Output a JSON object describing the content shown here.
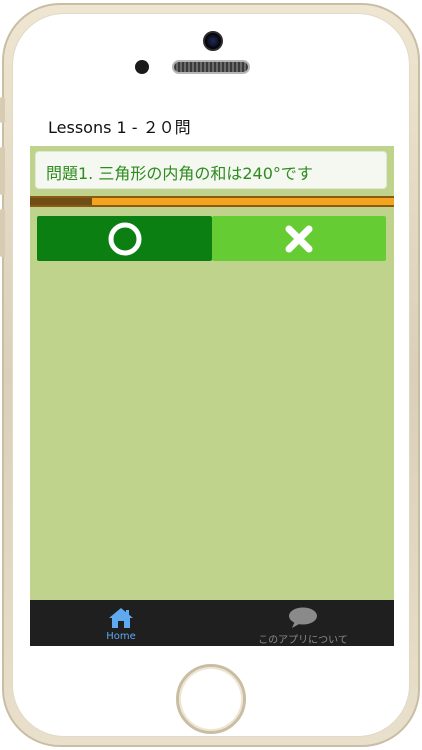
{
  "header": {
    "title": "Lessons 1 - ２０問"
  },
  "question": {
    "text": "問題1. 三角形の内角の和は240°です"
  },
  "progress": {
    "fraction": 0.17
  },
  "answers": {
    "correct_icon": "circle-icon",
    "wrong_icon": "cross-icon"
  },
  "tabbar": {
    "items": [
      {
        "label": "Home",
        "icon": "home-icon",
        "active": true
      },
      {
        "label": "このアプリについて",
        "icon": "speech-bubble-icon",
        "active": false
      }
    ]
  },
  "colors": {
    "content_bg": "#c0d38c",
    "question_text": "#2e8b1e",
    "correct_button": "#0b7f12",
    "wrong_button": "#66cc33",
    "progress_track": "#f3a51f",
    "progress_fill": "#6e4e16",
    "tabbar_bg": "#1f1f1f",
    "tab_active": "#5ea9f0",
    "tab_inactive": "#8a8a8a"
  }
}
